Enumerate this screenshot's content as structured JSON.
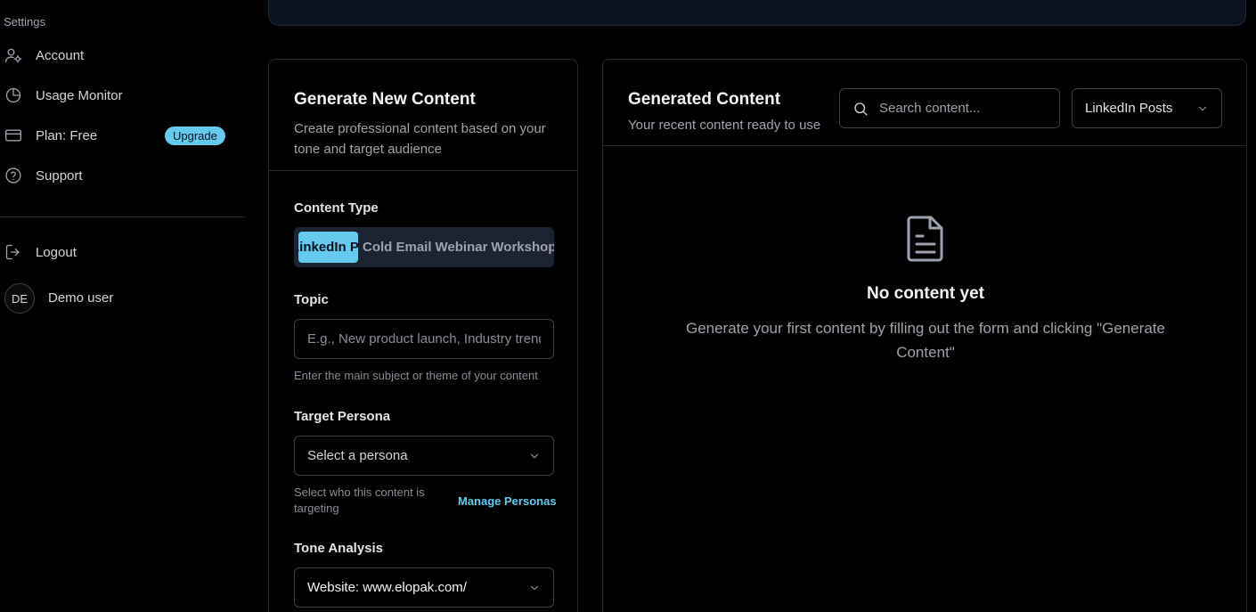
{
  "sidebar": {
    "section_label": "Settings",
    "items": [
      {
        "label": "Account",
        "icon": "user-gear-icon"
      },
      {
        "label": "Usage Monitor",
        "icon": "pie-chart-icon"
      },
      {
        "label": "Plan: Free",
        "icon": "credit-card-icon",
        "badge": "Upgrade"
      },
      {
        "label": "Support",
        "icon": "help-circle-icon"
      }
    ],
    "logout_label": "Logout",
    "user": {
      "initials": "DE",
      "name": "Demo user"
    }
  },
  "generate": {
    "title": "Generate New Content",
    "description": "Create professional content based on your tone and target audience",
    "content_type_label": "Content Type",
    "content_types": [
      "LinkedIn Post",
      "Cold Email",
      "Webinar",
      "Workshop"
    ],
    "active_type": "LinkedIn Post",
    "topic_label": "Topic",
    "topic_placeholder": "E.g., New product launch, Industry trends",
    "topic_value": "",
    "topic_help": "Enter the main subject or theme of your content",
    "persona_label": "Target Persona",
    "persona_value": "Select a persona",
    "persona_help": "Select who this content is targeting",
    "manage_personas": "Manage Personas",
    "tone_label": "Tone Analysis",
    "tone_value": "Website: www.elopak.com/"
  },
  "generated": {
    "title": "Generated Content",
    "description": "Your recent content ready to use",
    "search_placeholder": "Search content...",
    "filter_value": "LinkedIn Posts",
    "empty_title": "No content yet",
    "empty_description": "Generate your first content by filling out the form and clicking \"Generate Content\""
  },
  "colors": {
    "accent": "#66c9ee",
    "background": "#000000",
    "banner": "#0d1321",
    "border": "#27272a"
  }
}
